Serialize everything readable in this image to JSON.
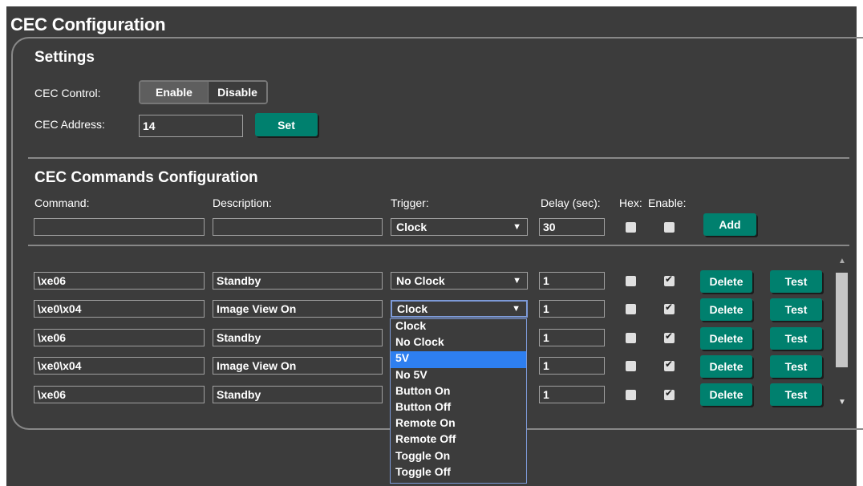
{
  "title": "CEC Configuration",
  "settings": {
    "heading": "Settings",
    "cec_control_label": "CEC Control:",
    "enable_label": "Enable",
    "disable_label": "Disable",
    "cec_address_label": "CEC Address:",
    "cec_address_value": "14",
    "set_label": "Set"
  },
  "commands": {
    "heading": "CEC Commands Configuration",
    "col_command": "Command:",
    "col_description": "Description:",
    "col_trigger": "Trigger:",
    "col_delay": "Delay (sec):",
    "col_hex": "Hex:",
    "col_enable": "Enable:",
    "new_command": "",
    "new_description": "",
    "new_trigger": "Clock",
    "new_delay": "30",
    "new_hex": false,
    "new_enable": false,
    "add_label": "Add",
    "delete_label": "Delete",
    "test_label": "Test"
  },
  "rows": [
    {
      "command": "\\xe06",
      "description": "Standby",
      "trigger": "No Clock",
      "delay": "1",
      "hex": false,
      "enable": true
    },
    {
      "command": "\\xe0\\x04",
      "description": "Image View On",
      "trigger": "Clock",
      "delay": "1",
      "hex": false,
      "enable": true
    },
    {
      "command": "\\xe06",
      "description": "Standby",
      "trigger": "",
      "delay": "1",
      "hex": false,
      "enable": true
    },
    {
      "command": "\\xe0\\x04",
      "description": "Image View On",
      "trigger": "",
      "delay": "1",
      "hex": false,
      "enable": true
    },
    {
      "command": "\\xe06",
      "description": "Standby",
      "trigger": "",
      "delay": "1",
      "hex": false,
      "enable": true
    }
  ],
  "trigger_dropdown": {
    "highlighted": "5V",
    "options": [
      "Clock",
      "No Clock",
      "5V",
      "No 5V",
      "Button On",
      "Button Off",
      "Remote On",
      "Remote Off",
      "Toggle On",
      "Toggle Off"
    ]
  },
  "icons": {
    "dropdown_arrow": "▼",
    "scroll_up": "▲",
    "scroll_down": "▼"
  },
  "colors": {
    "background": "#3c3c3c",
    "accent_button": "#00806e",
    "dropdown_highlight": "#2e7ff0",
    "segment_active": "#5e5e5e"
  }
}
